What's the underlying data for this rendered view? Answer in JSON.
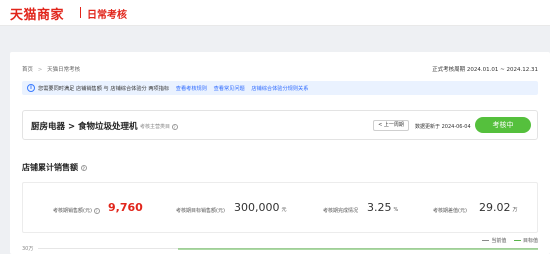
{
  "header": {
    "brand": "天猫商家",
    "subtitle": "日常考核"
  },
  "breadcrumb": {
    "home": "首页",
    "separator": ">",
    "current": "天猫日常考核"
  },
  "assessment_period": {
    "text": "正式考核周期 2024.01.01 ~ 2024.12.31"
  },
  "notice": {
    "icon": "info-icon",
    "text": "您需要同时满足 店铺销售额 与 店铺综合体验分 两项指标",
    "links": [
      "查看考核规则",
      "查看常见问题",
      "店铺综合体验分规则关系"
    ]
  },
  "category_card": {
    "title": "厨房电器 > 食物垃圾处理机",
    "subtitle": "考核主营类目",
    "prev_period_label": "< 上一周期",
    "updated_text": "数据更新于 2024-06-04",
    "assess_button_label": "考核中"
  },
  "sales_section": {
    "title": "店铺累计销售额",
    "kpis": [
      {
        "label": "考核期销售额(元)",
        "value": "9,760",
        "unit": ""
      },
      {
        "label": "考核期目标销售额(元)",
        "value": "300,000",
        "unit": "元"
      },
      {
        "label": "考核期完成情况",
        "value": "3.25",
        "unit": "%"
      },
      {
        "label": "考核期差值(元)",
        "value": "29.02",
        "unit": "万"
      }
    ],
    "legend": [
      {
        "name": "当前值",
        "color": "#8a8a8a"
      },
      {
        "name": "目标值",
        "color": "#5ab54a"
      }
    ],
    "y_axis_top_label": "30万"
  },
  "colors": {
    "brand_red": "#e1251b",
    "accent_green": "#55c03d",
    "link_blue": "#2f6bff"
  }
}
